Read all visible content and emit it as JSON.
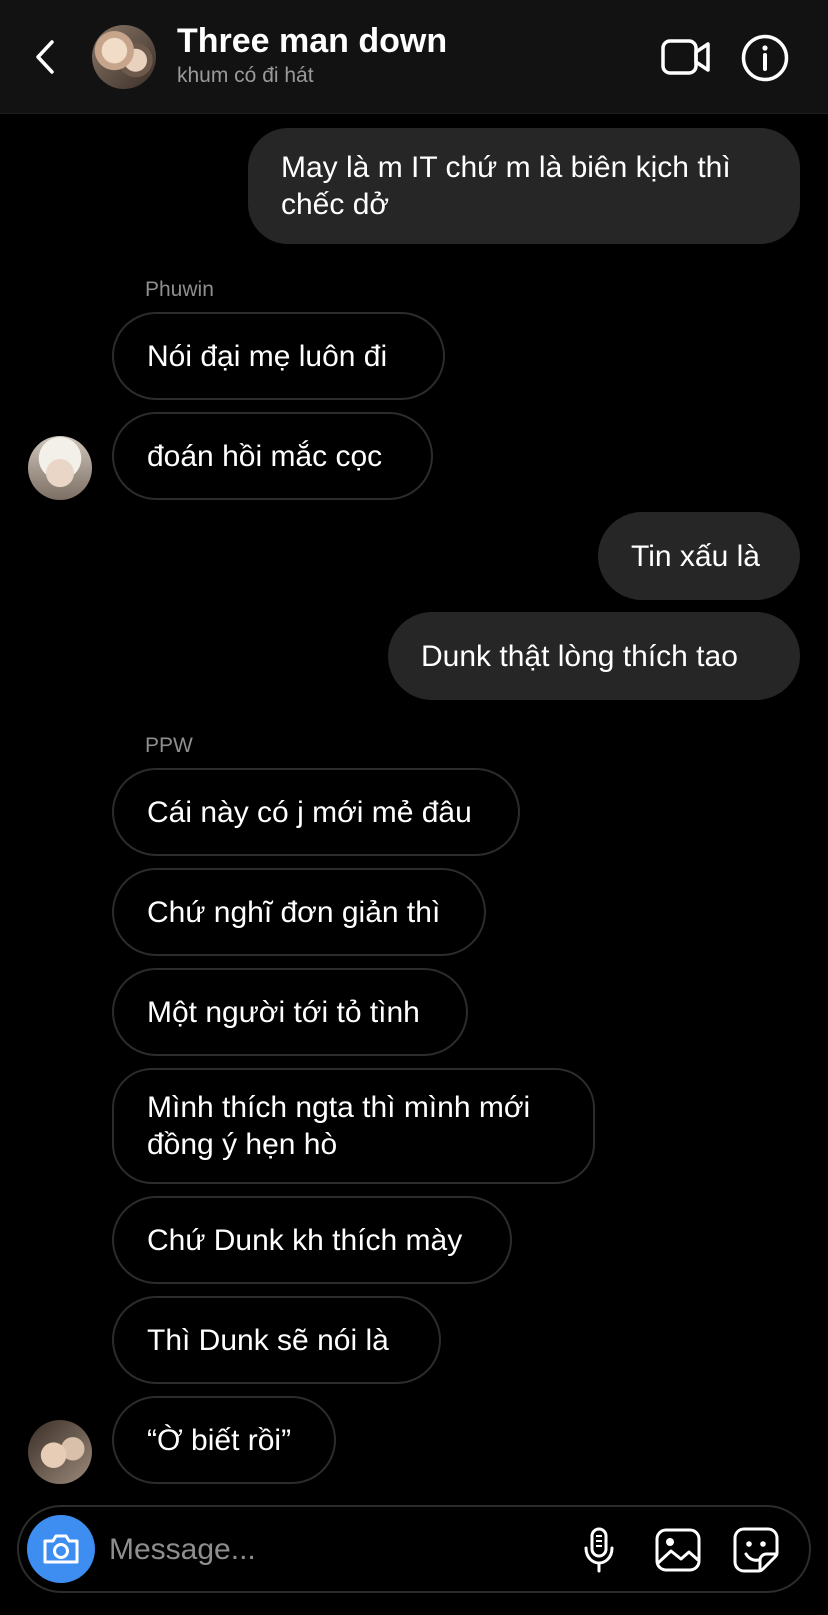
{
  "header": {
    "title": "Three man down",
    "subtitle": "khum có đi hát",
    "back_icon": "chevron-left-icon",
    "video_icon": "video-camera-icon",
    "info_icon": "info-icon"
  },
  "messages": [
    {
      "id": "m1",
      "side": "out",
      "lines": [
        "May là m IT chứ m là biên kịch thì",
        "chếc dở"
      ]
    },
    {
      "id": "m2",
      "side": "in",
      "sender": "Phuwin",
      "text": "Nói đại mẹ luôn đi"
    },
    {
      "id": "m3",
      "side": "in",
      "text": "đoán hồi mắc cọc"
    },
    {
      "id": "m4",
      "side": "out",
      "text": "Tin xấu là"
    },
    {
      "id": "m5",
      "side": "out",
      "text": "Dunk thật lòng thích tao"
    },
    {
      "id": "m6",
      "side": "in",
      "sender": "PPW",
      "text": "Cái này có j mới mẻ đâu"
    },
    {
      "id": "m7",
      "side": "in",
      "text": "Chứ nghĩ đơn giản thì"
    },
    {
      "id": "m8",
      "side": "in",
      "text": "Một người tới tỏ tình"
    },
    {
      "id": "m9",
      "side": "in",
      "lines": [
        "Mình thích ngta thì mình mới",
        "đồng ý hẹn hò"
      ]
    },
    {
      "id": "m10",
      "side": "in",
      "text": "Chứ Dunk kh thích mày"
    },
    {
      "id": "m11",
      "side": "in",
      "text": "Thì Dunk sẽ nói là"
    },
    {
      "id": "m12",
      "side": "in",
      "text": "“Ờ biết rồi”"
    }
  ],
  "composer": {
    "placeholder": "Message...",
    "value": "",
    "camera_icon": "camera-icon",
    "mic_icon": "microphone-icon",
    "gallery_icon": "image-gallery-icon",
    "sticker_icon": "sticker-icon"
  },
  "colors": {
    "background": "#000000",
    "outgoing_bubble": "#262626",
    "incoming_border": "#2c2c2c",
    "camera_button": "#3d8ef0",
    "secondary_text": "#8e8e8e"
  }
}
